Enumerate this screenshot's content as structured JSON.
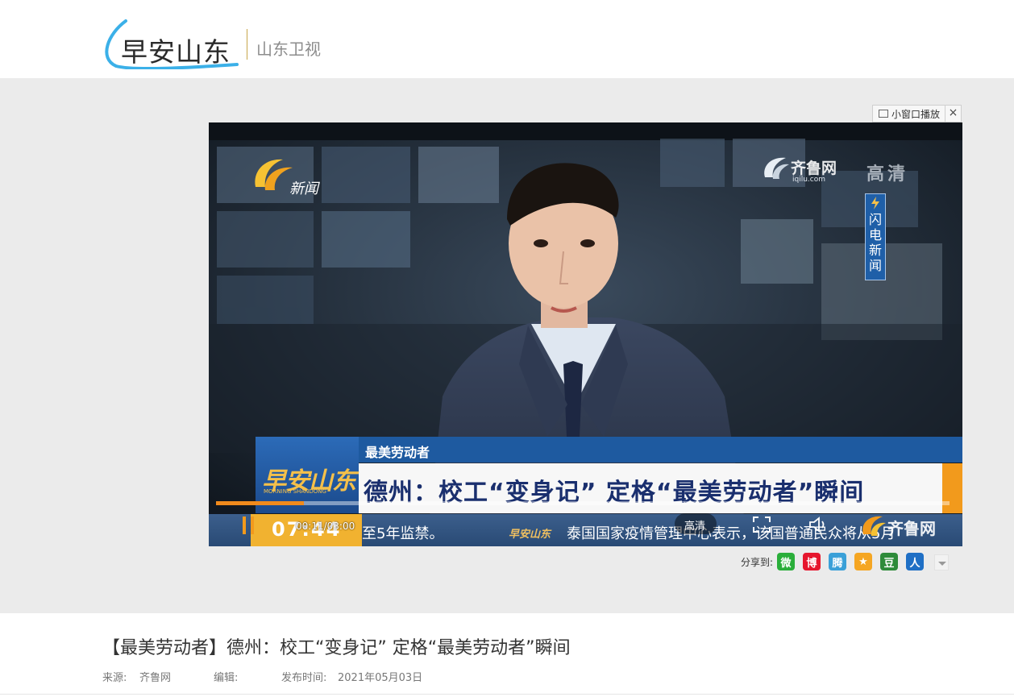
{
  "header": {
    "logo_text": "早安山东",
    "channel": "山东卫视"
  },
  "player": {
    "mini_window_label": "小窗口播放",
    "close_glyph": "×",
    "overlay": {
      "news_brand": "新闻",
      "top_right_brand": "齐鲁网",
      "top_right_url": "iqilu.com",
      "hd_watermark": "高清",
      "flash_news": [
        "闪",
        "电",
        "新",
        "闻"
      ],
      "program_logo": "早安山东",
      "program_logo_sub": "MORNING SHANDONG",
      "category": "最美劳动者",
      "headline": "德州：校工“变身记” 定格“最美劳动者”瞬间",
      "ticker_clock": "07:44",
      "ticker_text_a": "至5年监禁。",
      "ticker_logo": "早安山东",
      "ticker_text_b": "泰国国家疫情管理中心表示，该国普通民众将从5月"
    },
    "controls": {
      "time": "00:11/03:00",
      "quality": "高清",
      "brand": "齐鲁网",
      "progress": 0.12
    }
  },
  "share": {
    "label": "分享到:",
    "targets": [
      {
        "icon": "wechat-icon",
        "glyph": "微",
        "color": "#2aae3a"
      },
      {
        "icon": "weibo-icon",
        "glyph": "博",
        "color": "#e6162d"
      },
      {
        "icon": "tencent-weibo-icon",
        "glyph": "腾",
        "color": "#3aa0d8"
      },
      {
        "icon": "qzone-icon",
        "glyph": "★",
        "color": "#f5a623"
      },
      {
        "icon": "douban-icon",
        "glyph": "豆",
        "color": "#2e8b3a"
      },
      {
        "icon": "renren-icon",
        "glyph": "人",
        "color": "#1f6fc5"
      }
    ]
  },
  "article": {
    "title": "【最美劳动者】德州：校工“变身记” 定格“最美劳动者”瞬间",
    "source_label": "来源:",
    "source_value": "齐鲁网",
    "editor_label": "编辑:",
    "editor_value": "",
    "publish_label": "发布时间:",
    "publish_value": "2021年05月03日"
  },
  "colors": {
    "accent_orange": "#f08a1c",
    "lower_third_blue": "#1e5aa0",
    "headline_navy": "#1a2f6e",
    "band_gray": "#ebebeb"
  }
}
